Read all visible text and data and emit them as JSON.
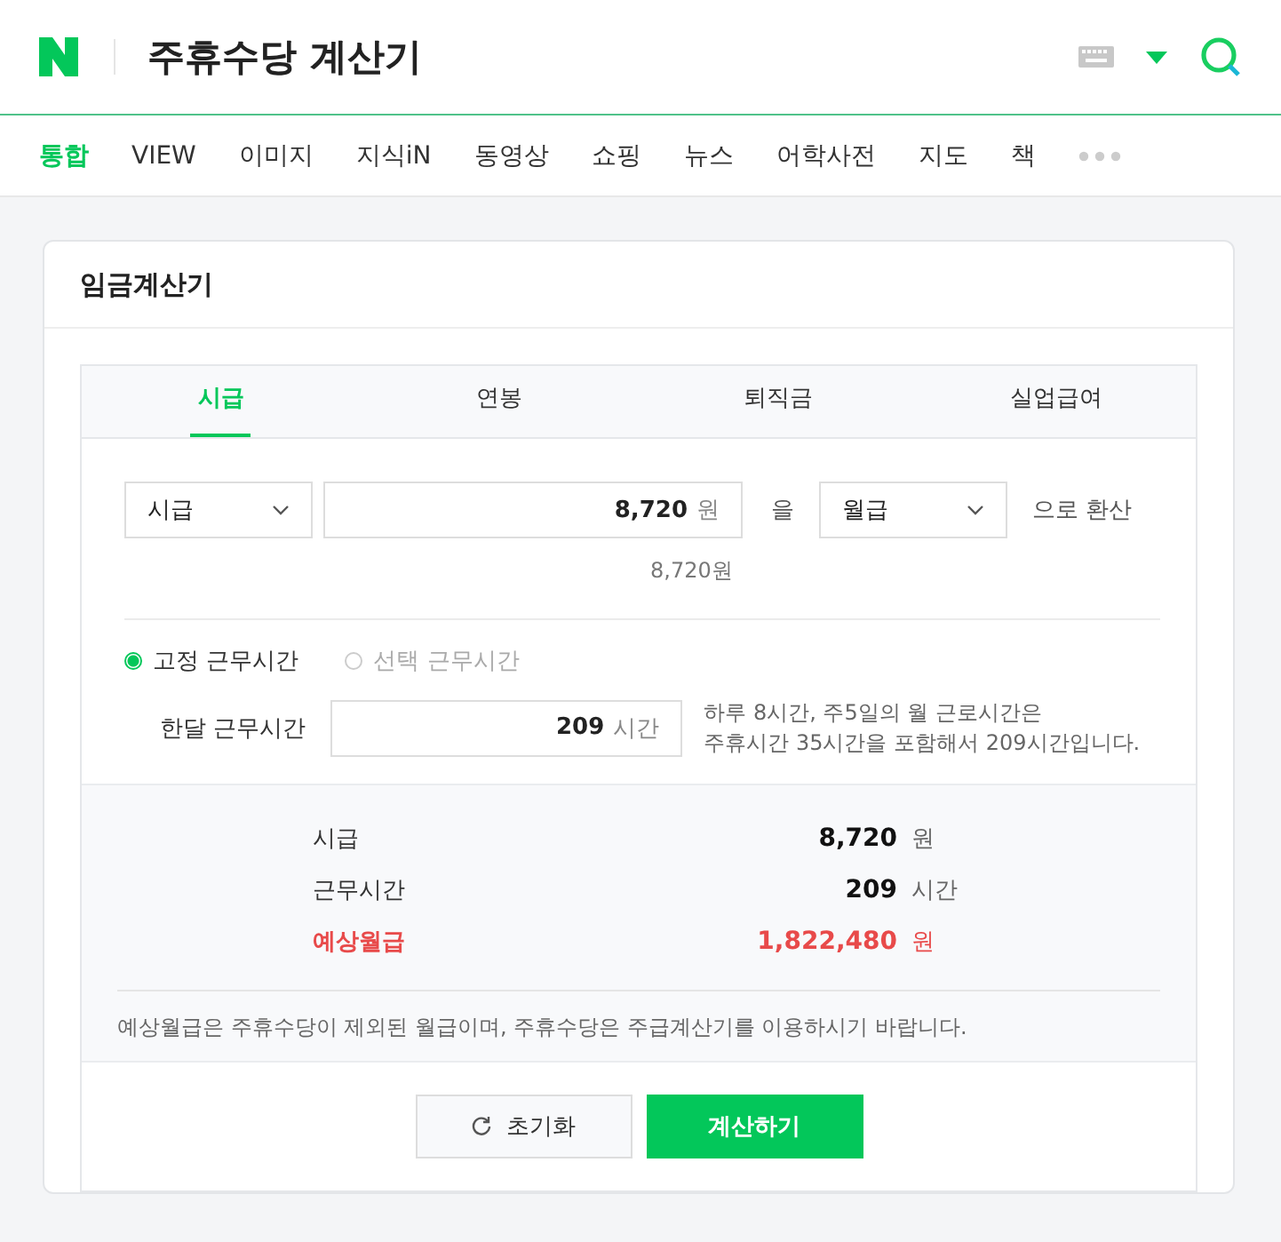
{
  "header": {
    "title": "주휴수당 계산기"
  },
  "nav": [
    {
      "label": "통합",
      "selected": true
    },
    {
      "label": "VIEW",
      "selected": false
    },
    {
      "label": "이미지",
      "selected": false
    },
    {
      "label": "지식iN",
      "selected": false
    },
    {
      "label": "동영상",
      "selected": false
    },
    {
      "label": "쇼핑",
      "selected": false
    },
    {
      "label": "뉴스",
      "selected": false
    },
    {
      "label": "어학사전",
      "selected": false
    },
    {
      "label": "지도",
      "selected": false
    },
    {
      "label": "책",
      "selected": false
    }
  ],
  "card": {
    "title": "임금계산기"
  },
  "tabs": [
    {
      "label": "시급",
      "selected": true
    },
    {
      "label": "연봉",
      "selected": false
    },
    {
      "label": "퇴직금",
      "selected": false
    },
    {
      "label": "실업급여",
      "selected": false
    }
  ],
  "conversion": {
    "from": "시급",
    "amount": "8,720",
    "amount_unit": "원",
    "particle": "을",
    "to": "월급",
    "suffix": "으로 환산",
    "preview": "8,720원"
  },
  "work_modes": [
    {
      "label": "고정 근무시간",
      "selected": true
    },
    {
      "label": "선택 근무시간",
      "selected": false
    }
  ],
  "monthly_hours": {
    "label": "한달 근무시간",
    "value": "209",
    "unit": "시간",
    "note_lines": [
      "하루 8시간, 주5일의 월 근로시간은",
      "주휴시간 35시간을 포함해서 209시간입니다."
    ]
  },
  "results": [
    {
      "label": "시급",
      "value": "8,720",
      "unit": "원",
      "emphasized": false
    },
    {
      "label": "근무시간",
      "value": "209",
      "unit": "시간",
      "emphasized": false
    },
    {
      "label": "예상월급",
      "value": "1,822,480",
      "unit": "원",
      "emphasized": true
    }
  ],
  "notice": "예상월급은 주휴수당이 제외된 월급이며, 주휴수당은 주급계산기를 이용하시기 바랍니다.",
  "buttons": {
    "reset": "초기화",
    "calculate": "계산하기"
  }
}
